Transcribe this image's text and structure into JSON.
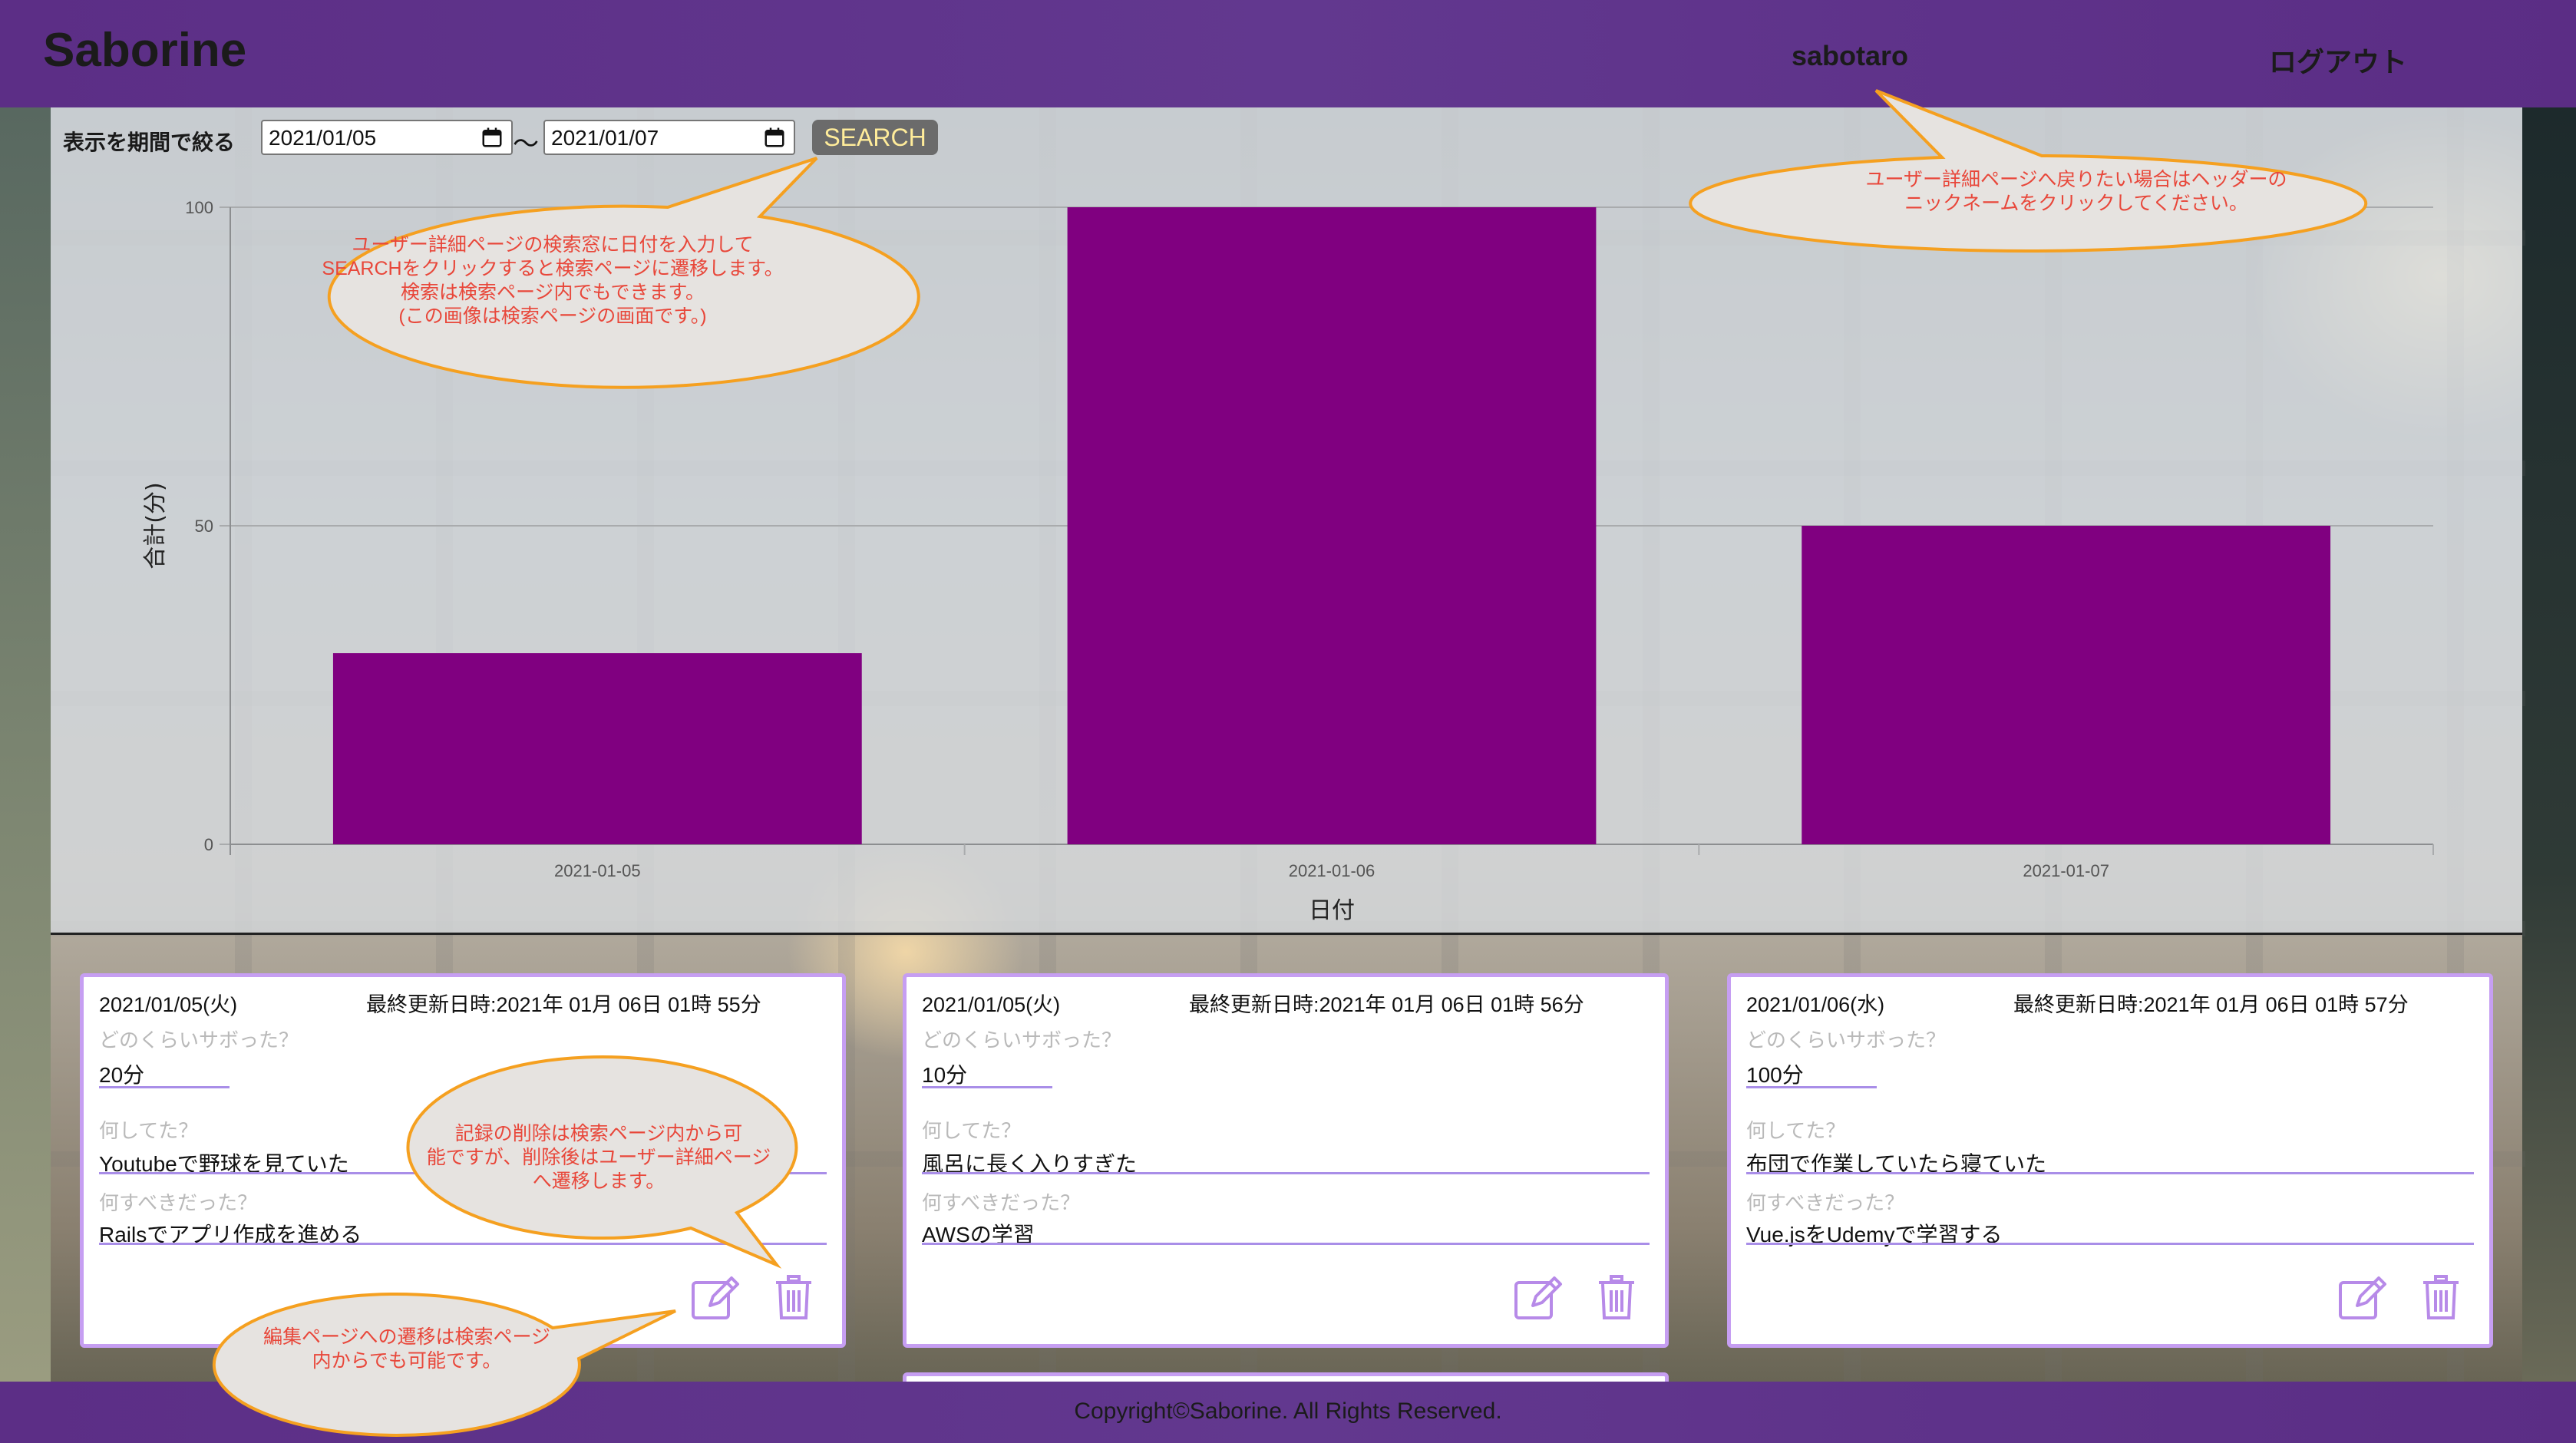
{
  "header": {
    "logo": "Saborine",
    "nickname": "sabotaro",
    "logout": "ログアウト"
  },
  "filter": {
    "label": "表示を期間で絞る",
    "start_date": "2021/01/05",
    "separator": "〜",
    "end_date": "2021/01/07",
    "search_label": "SEARCH"
  },
  "chart_data": {
    "type": "bar",
    "categories": [
      "2021-01-05",
      "2021-01-06",
      "2021-01-07"
    ],
    "values": [
      30,
      100,
      50
    ],
    "ylim": [
      0,
      100
    ],
    "yticks": [
      0,
      50,
      100
    ],
    "xlabel": "日付",
    "ylabel": "合計(分)",
    "bar_color": "#800080",
    "grid": true
  },
  "cards": [
    {
      "date": "2021/01/05(火)",
      "updated": "最終更新日時:2021年 01月 06日 01時 55分",
      "q_amount": "どのくらいサボった？",
      "amount": "20分",
      "q_doing": "何してた？",
      "doing": "Youtubeで野球を見ていた",
      "q_should": "何すべきだった？",
      "should": "Railsでアプリ作成を進める"
    },
    {
      "date": "2021/01/05(火)",
      "updated": "最終更新日時:2021年 01月 06日 01時 56分",
      "q_amount": "どのくらいサボった？",
      "amount": "10分",
      "q_doing": "何してた？",
      "doing": "風呂に長く入りすぎた",
      "q_should": "何すべきだった？",
      "should": "AWSの学習"
    },
    {
      "date": "2021/01/06(水)",
      "updated": "最終更新日時:2021年 01月 06日 01時 57分",
      "q_amount": "どのくらいサボった？",
      "amount": "100分",
      "q_doing": "何してた？",
      "doing": "布団で作業していたら寝ていた",
      "q_should": "何すべきだった？",
      "should": "Vue.jsをUdemyで学習する"
    }
  ],
  "annotations": {
    "search_note": [
      "ユーザー詳細ページの検索窓に日付を入力して",
      "SEARCHをクリックすると検索ページに遷移します。",
      "検索は検索ページ内でもできます。",
      "(この画像は検索ページの画面です。)"
    ],
    "header_note": [
      "ユーザー詳細ページへ戻りたい場合はヘッダーの",
      "ニックネームをクリックしてください。"
    ],
    "delete_note": [
      "記録の削除は検索ページ内から可",
      "能ですが、削除後はユーザー詳細ページ",
      "へ遷移します。"
    ],
    "edit_note": [
      "編集ページへの遷移は検索ページ",
      "内からでも可能です。"
    ]
  },
  "footer": {
    "copyright": "Copyright©Saborine. All Rights Reserved."
  },
  "colors": {
    "header_bg": "#5e318a",
    "bar": "#800080",
    "card_border": "#c69ef2",
    "search_button": "#6b6b6b",
    "annotation_text": "#e8473a",
    "annotation_border": "#f5a020"
  },
  "icons": [
    "calendar-icon",
    "edit-icon",
    "trash-icon"
  ]
}
